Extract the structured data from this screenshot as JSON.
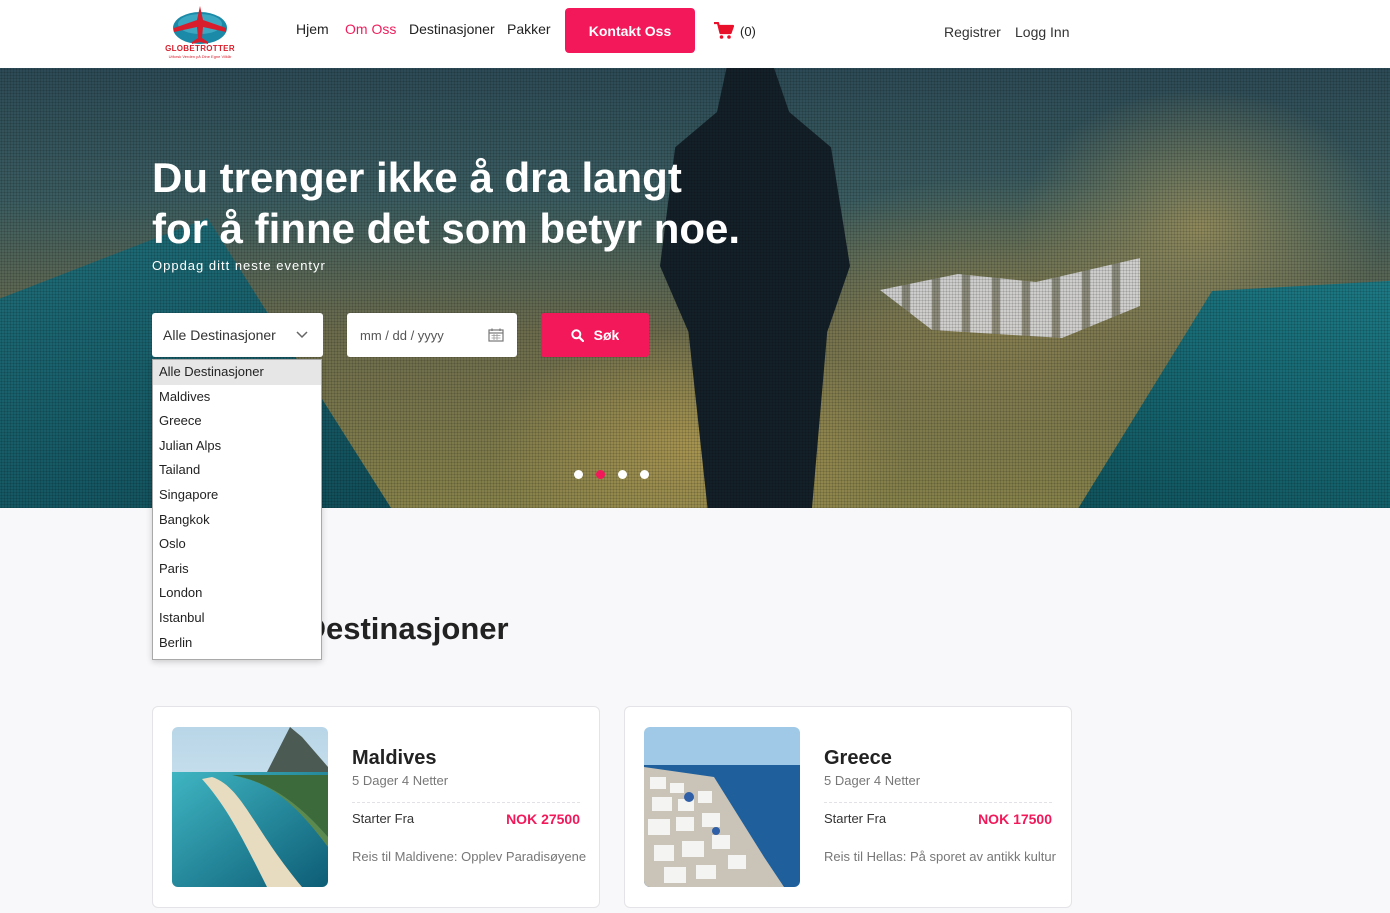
{
  "brand": {
    "name": "GLOBETROTTER",
    "tagline": "Utforsk Verden på Dine Egne Vilkår",
    "primary_color": "#f3185a"
  },
  "nav": {
    "items": [
      {
        "label": "Hjem",
        "active": false
      },
      {
        "label": "Om Oss",
        "active": true
      },
      {
        "label": "Destinasjoner",
        "active": false
      },
      {
        "label": "Pakker",
        "active": false
      }
    ],
    "contact_label": "Kontakt Oss",
    "cart_icon": "cart-icon",
    "cart_count": "(0)",
    "register_label": "Registrer",
    "login_label": "Logg Inn"
  },
  "hero": {
    "title_line1": "Du trenger ikke å dra langt",
    "title_line2": "for å finne det som betyr noe.",
    "subtitle": "Oppdag ditt neste eventyr",
    "destination_select": {
      "selected": "Alle Destinasjoner",
      "options": [
        "Alle Destinasjoner",
        "Maldives",
        "Greece",
        "Julian Alps",
        "Tailand",
        "Singapore",
        "Bangkok",
        "Oslo",
        "Paris",
        "London",
        "Istanbul",
        "Berlin"
      ]
    },
    "date_placeholder": "mm / dd / yyyy",
    "search_label": "Søk",
    "carousel_active_slide": 2,
    "carousel_slides": 4
  },
  "section": {
    "title": "Populære Destinasjoner",
    "title_visible": "estinasjoner"
  },
  "cards": [
    {
      "name": "Maldives",
      "duration": "5 Dager 4 Netter",
      "from_label": "Starter Fra",
      "price": "NOK 27500",
      "description": "Reis til Maldivene: Opplev Paradisøyene"
    },
    {
      "name": "Greece",
      "duration": "5 Dager 4 Netter",
      "from_label": "Starter Fra",
      "price": "NOK 17500",
      "description": "Reis til Hellas: På sporet av antikk kultur"
    }
  ]
}
